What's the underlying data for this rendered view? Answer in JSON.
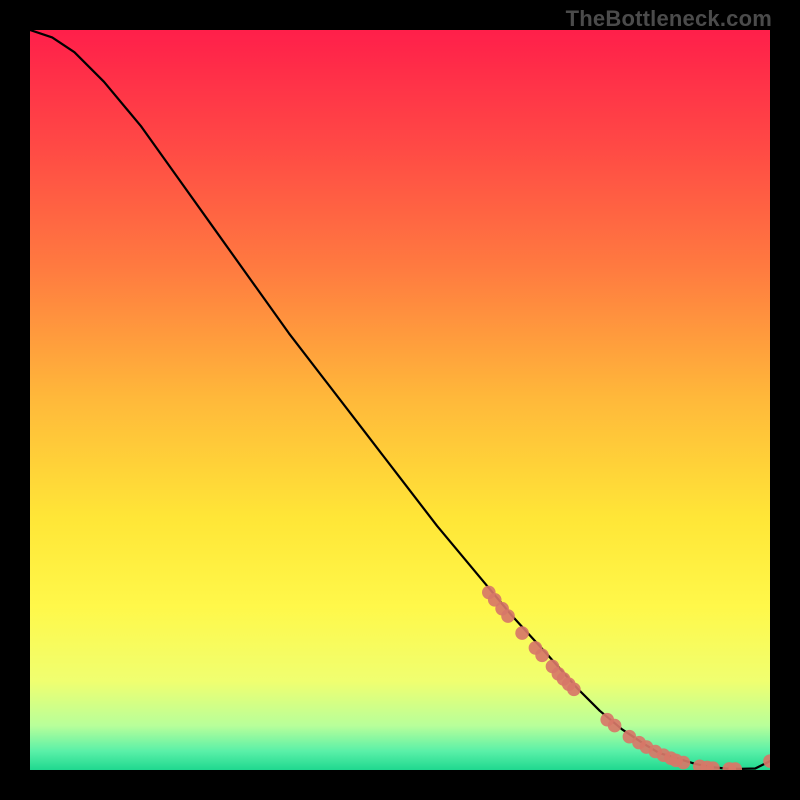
{
  "watermark": "TheBottleneck.com",
  "chart_data": {
    "type": "line",
    "title": "",
    "xlabel": "",
    "ylabel": "",
    "xlim": [
      0,
      100
    ],
    "ylim": [
      0,
      100
    ],
    "grid": false,
    "legend": false,
    "series": [
      {
        "name": "curve",
        "color": "#000000",
        "x": [
          0,
          3,
          6,
          10,
          15,
          20,
          25,
          30,
          35,
          40,
          45,
          50,
          55,
          60,
          65,
          70,
          74,
          77,
          80,
          83,
          85,
          88,
          90,
          92,
          94,
          96,
          98,
          100
        ],
        "y": [
          100,
          99,
          97,
          93,
          87,
          80,
          73,
          66,
          59,
          52.5,
          46,
          39.5,
          33,
          27,
          21,
          15.5,
          11,
          8,
          5.5,
          3.5,
          2.3,
          1.4,
          0.8,
          0.4,
          0.2,
          0.15,
          0.2,
          1.2
        ]
      },
      {
        "name": "markers",
        "color": "#d77768",
        "type": "scatter",
        "x": [
          62.0,
          62.8,
          63.8,
          64.6,
          66.5,
          68.3,
          69.2,
          70.6,
          71.4,
          72.1,
          72.8,
          73.5,
          78.0,
          79.0,
          81.0,
          82.3,
          83.3,
          84.5,
          85.6,
          86.6,
          87.3,
          88.3,
          90.5,
          91.5,
          92.3,
          94.5,
          95.3,
          100.0
        ],
        "y": [
          24.0,
          23.0,
          21.8,
          20.8,
          18.5,
          16.5,
          15.5,
          14.0,
          13.0,
          12.3,
          11.6,
          10.9,
          6.8,
          6.0,
          4.5,
          3.7,
          3.1,
          2.5,
          2.0,
          1.6,
          1.3,
          1.0,
          0.5,
          0.35,
          0.25,
          0.15,
          0.12,
          1.2
        ]
      }
    ],
    "background_gradient": {
      "stops": [
        {
          "pos": 0.0,
          "color": "#ff1f4a"
        },
        {
          "pos": 0.16,
          "color": "#ff4a45"
        },
        {
          "pos": 0.32,
          "color": "#ff7a40"
        },
        {
          "pos": 0.5,
          "color": "#ffb93a"
        },
        {
          "pos": 0.66,
          "color": "#ffe637"
        },
        {
          "pos": 0.78,
          "color": "#fff84a"
        },
        {
          "pos": 0.88,
          "color": "#f0ff70"
        },
        {
          "pos": 0.94,
          "color": "#b8ff9a"
        },
        {
          "pos": 0.975,
          "color": "#59f0a8"
        },
        {
          "pos": 1.0,
          "color": "#1fd88f"
        }
      ]
    }
  }
}
